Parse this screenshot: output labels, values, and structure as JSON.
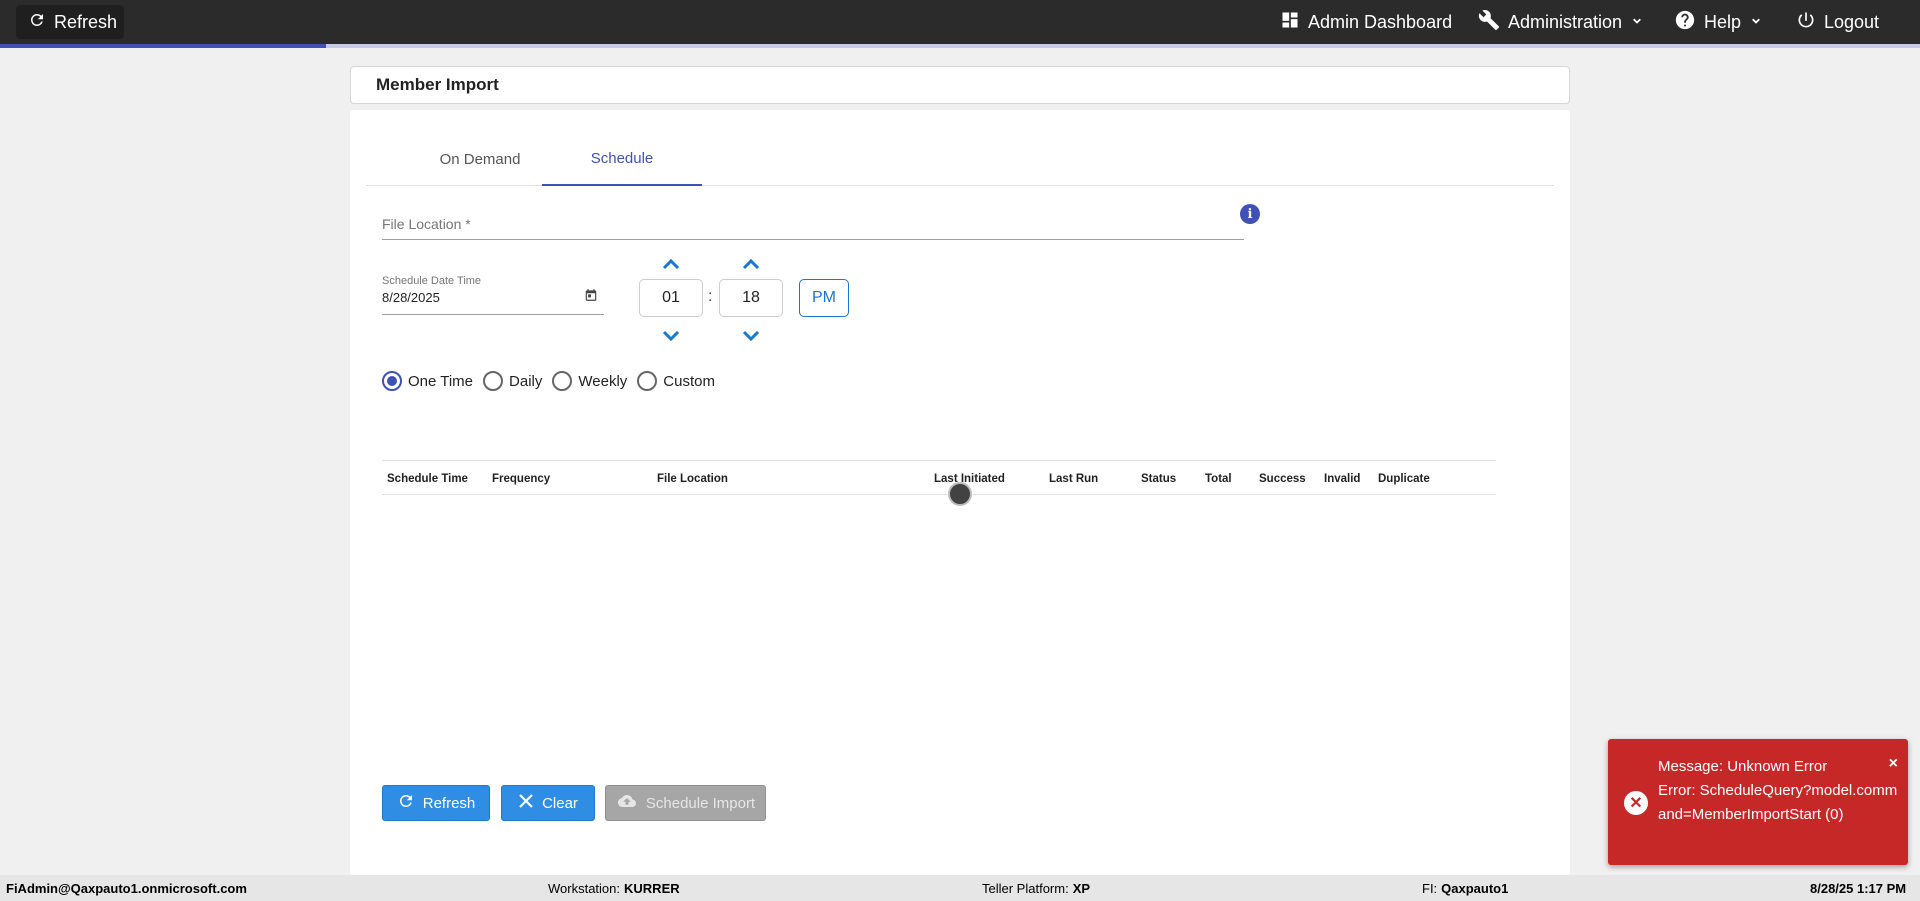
{
  "topbar": {
    "refresh_label": "Refresh",
    "admin_dashboard_label": "Admin Dashboard",
    "administration_label": "Administration",
    "help_label": "Help",
    "logout_label": "Logout",
    "progress_fraction": 0.17
  },
  "page": {
    "title": "Member Import"
  },
  "tabs": [
    {
      "label": "On Demand",
      "active": false
    },
    {
      "label": "Schedule",
      "active": true
    }
  ],
  "form": {
    "file_location_label": "File Location *",
    "file_location_value": "",
    "schedule_date_label": "Schedule Date Time",
    "schedule_date_value": "8/28/2025",
    "hour": "01",
    "minute": "18",
    "time_separator": ":",
    "ampm": "PM",
    "info_glyph": "i",
    "frequency_options": [
      {
        "label": "One Time",
        "checked": true
      },
      {
        "label": "Daily",
        "checked": false
      },
      {
        "label": "Weekly",
        "checked": false
      },
      {
        "label": "Custom",
        "checked": false
      }
    ]
  },
  "table": {
    "columns": [
      "Schedule Time",
      "Frequency",
      "File Location",
      "Last Initiated",
      "Last Run",
      "Status",
      "Total",
      "Success",
      "Invalid",
      "Duplicate"
    ],
    "rows": []
  },
  "actions": {
    "refresh_label": "Refresh",
    "clear_label": "Clear",
    "schedule_import_label": "Schedule Import"
  },
  "statusbar": {
    "user": "FiAdmin@Qaxpauto1.onmicrosoft.com",
    "workstation_label": "Workstation:",
    "workstation_value": "KURRER",
    "platform_label": "Teller Platform:",
    "platform_value": "XP",
    "fi_label": "FI:",
    "fi_value": "Qaxpauto1",
    "datetime": "8/28/25 1:17 PM"
  },
  "toast": {
    "line1": "Message: Unknown Error",
    "line2": "Error: ScheduleQuery?model.command=MemberImportStart (0)",
    "close_glyph": "×",
    "icon_glyph": "✕"
  },
  "colors": {
    "accent": "#3f51b5",
    "button_primary": "#2f8de4",
    "error": "#c62828",
    "topbar": "#2b2b2b"
  },
  "icons": {
    "topbar_refresh": "refresh-icon",
    "admin_dashboard": "dashboard-icon",
    "administration": "wrench-icon",
    "help": "help-circle-icon",
    "logout": "power-icon"
  }
}
